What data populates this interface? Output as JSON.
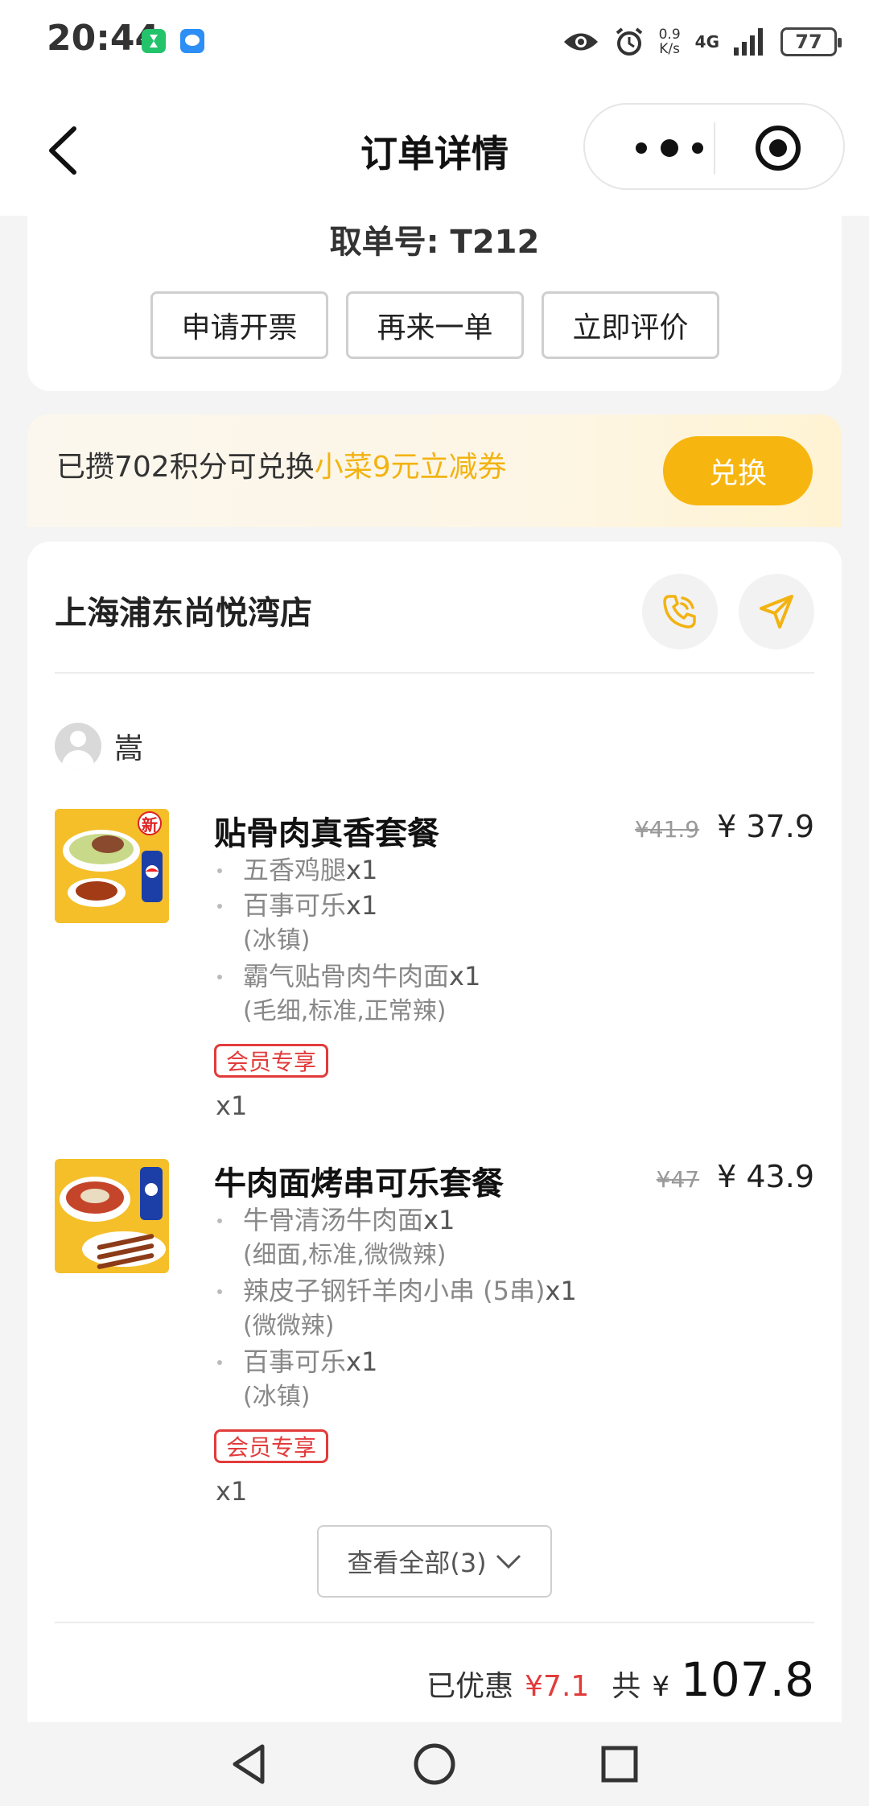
{
  "status_bar": {
    "time": "20:44",
    "net_speed_value": "0.9",
    "net_speed_unit": "K/s",
    "network": "4G",
    "battery": "77"
  },
  "nav": {
    "title": "订单详情"
  },
  "order": {
    "pickup_label": "取单号: T212",
    "actions": [
      "申请开票",
      "再来一单",
      "立即评价"
    ]
  },
  "points": {
    "text_prefix": "已攒702积分可兑换",
    "highlight": "小菜9元立减券",
    "button": "兑换",
    "highlight_color": "#f2b312",
    "button_color": "#f7b50f"
  },
  "store": {
    "name": "上海浦东尚悦湾店",
    "phone_icon": "phone-icon",
    "nav_icon": "navigation-icon"
  },
  "user": {
    "name": "嵩"
  },
  "items": [
    {
      "name": "贴骨肉真香套餐",
      "price_old": "¥41.9",
      "price_new": "¥ 37.9",
      "subs": [
        {
          "name": "五香鸡腿",
          "qty": "x1",
          "options": ""
        },
        {
          "name": "百事可乐",
          "qty": "x1",
          "options": "(冰镇)"
        },
        {
          "name": "霸气贴骨肉牛肉面",
          "qty": "x1",
          "options": "(毛细,标准,正常辣)"
        }
      ],
      "tag": "会员专享",
      "quantity": "x1",
      "thumb_badge": "新"
    },
    {
      "name": "牛肉面烤串可乐套餐",
      "price_old": "¥47",
      "price_new": "¥ 43.9",
      "subs": [
        {
          "name": "牛骨清汤牛肉面",
          "qty": "x1",
          "options": "(细面,标准,微微辣)"
        },
        {
          "name": "辣皮子钢钎羊肉小串 (5串)",
          "qty": "x1",
          "options": "(微微辣)"
        },
        {
          "name": "百事可乐",
          "qty": "x1",
          "options": "(冰镇)"
        }
      ],
      "tag": "会员专享",
      "quantity": "x1"
    }
  ],
  "view_all": "查看全部(3)",
  "summary": {
    "discount_label": "已优惠",
    "discount_value": "¥7.1",
    "total_label": "共",
    "total_symbol": "¥",
    "total_value": "107.8",
    "discount_color": "#e23b3b"
  }
}
